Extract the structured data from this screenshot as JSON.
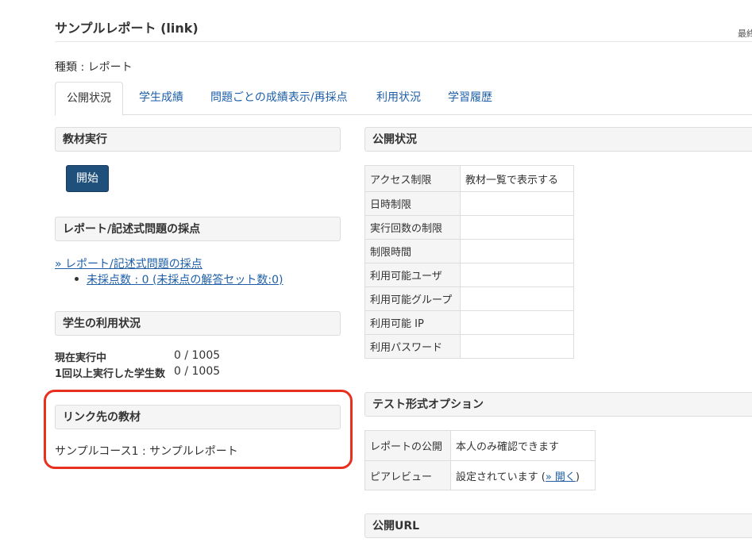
{
  "header": {
    "title": "サンプルレポート (link)",
    "top_right_text": "最終",
    "type_line": "種類 : レポート"
  },
  "tabs": [
    {
      "label": "公開状況",
      "active": true
    },
    {
      "label": "学生成績",
      "active": false
    },
    {
      "label": "問題ごとの成績表示/再採点",
      "active": false
    },
    {
      "label": "利用状況",
      "active": false
    },
    {
      "label": "学習履歴",
      "active": false
    }
  ],
  "left": {
    "execute": {
      "title": "教材実行",
      "start_label": "開始"
    },
    "grading": {
      "title": "レポート/記述式問題の採点",
      "link_label": "» レポート/記述式問題の採点",
      "bullet_label": "未採点数 : 0 (未採点の解答セット数:0)"
    },
    "usage": {
      "title": "学生の利用状況",
      "rows": [
        {
          "label": "現在実行中",
          "value": "0 / 1005"
        },
        {
          "label": "1回以上実行した学生数",
          "value": "0 / 1005"
        }
      ]
    },
    "linked": {
      "title": "リンク先の教材",
      "text": "サンプルコース1 : サンプルレポート"
    }
  },
  "right": {
    "publish": {
      "title": "公開状況",
      "rows": [
        {
          "label": "アクセス制限",
          "value": "教材一覧で表示する"
        },
        {
          "label": "日時制限",
          "value": ""
        },
        {
          "label": "実行回数の制限",
          "value": ""
        },
        {
          "label": "制限時間",
          "value": ""
        },
        {
          "label": "利用可能ユーザ",
          "value": ""
        },
        {
          "label": "利用可能グループ",
          "value": ""
        },
        {
          "label": "利用可能 IP",
          "value": ""
        },
        {
          "label": "利用パスワード",
          "value": ""
        }
      ]
    },
    "test_options": {
      "title": "テスト形式オプション",
      "report_label": "レポートの公開",
      "report_value": "本人のみ確認できます",
      "peer_label": "ピアレビュー",
      "peer_value_prefix": "設定されています (",
      "peer_link": "» 開く",
      "peer_value_suffix": ")"
    },
    "public_url": {
      "title": "公開URL"
    }
  },
  "colors": {
    "link": "#1e5fa8",
    "button_bg": "#1f4f7b",
    "highlight": "#e8301f",
    "panel_bg": "#f5f5f5"
  }
}
